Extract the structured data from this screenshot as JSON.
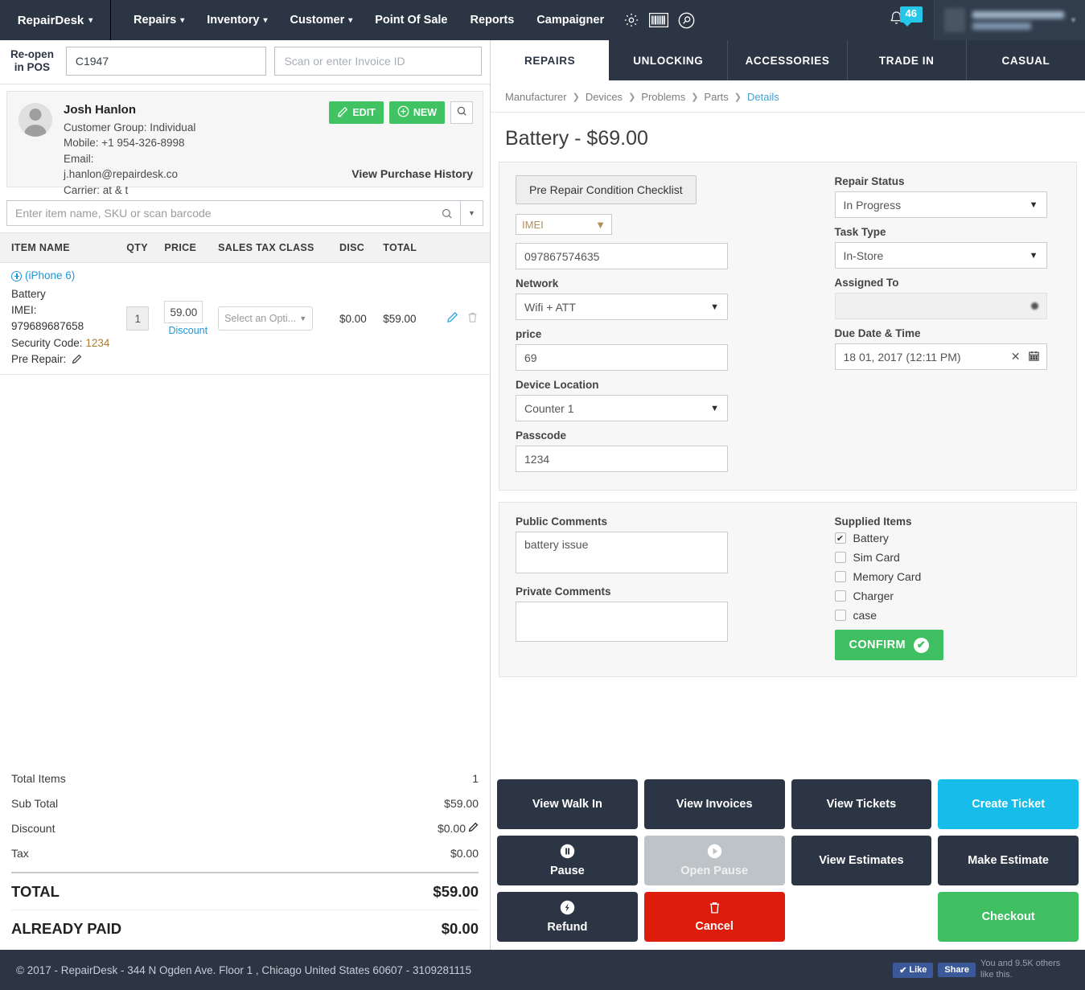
{
  "topnav": {
    "brand": "RepairDesk",
    "items": [
      {
        "label": "Repairs",
        "caret": true
      },
      {
        "label": "Inventory",
        "caret": true
      },
      {
        "label": "Customer",
        "caret": true
      },
      {
        "label": "Point Of Sale",
        "caret": false
      },
      {
        "label": "Reports",
        "caret": false
      },
      {
        "label": "Campaigner",
        "caret": false
      }
    ],
    "icons": [
      "gear-icon",
      "barcode-icon",
      "search-circle-icon"
    ],
    "notification_count": "46",
    "caret_glyph": "⌄"
  },
  "reopen": {
    "label_line1": "Re-open",
    "label_line2": "in POS",
    "ticket_value": "C1947",
    "ticket_placeholder": "",
    "invoice_placeholder": "Scan or enter Invoice ID",
    "invoice_value": ""
  },
  "customer": {
    "name": "Josh Hanlon",
    "group": "Customer Group: Individual",
    "mobile": "Mobile: +1 954-326-8998",
    "email_label": "Email:",
    "email": "j.hanlon@repairdesk.co",
    "carrier": "Carrier: at & t",
    "edit_label": "EDIT",
    "new_label": "NEW",
    "purchase_history": "View Purchase History"
  },
  "item_search": {
    "placeholder": "Enter item name, SKU or scan barcode",
    "value": ""
  },
  "cart": {
    "headers": [
      "ITEM NAME",
      "QTY",
      "PRICE",
      "SALES TAX CLASS",
      "DISC",
      "TOTAL"
    ],
    "row": {
      "device": "(iPhone 6)",
      "part": "Battery",
      "imei_label": "IMEI:",
      "imei_value": "979689687658",
      "security_label": "Security Code:",
      "security_value": "1234",
      "prerepair_label": "Pre Repair:",
      "qty": "1",
      "price": "59.00",
      "discount_link": "Discount",
      "tax_class": "Select an Opti...",
      "disc": "$0.00",
      "total": "$59.00"
    }
  },
  "totals": {
    "rows": [
      {
        "label": "Total Items",
        "value": "1",
        "editable": false
      },
      {
        "label": "Sub Total",
        "value": "$59.00",
        "editable": false
      },
      {
        "label": "Discount",
        "value": "$0.00",
        "editable": true
      },
      {
        "label": "Tax",
        "value": "$0.00",
        "editable": false
      }
    ],
    "total_label": "TOTAL",
    "total_value": "$59.00",
    "paid_label": "ALREADY PAID",
    "paid_value": "$0.00"
  },
  "tabs": [
    {
      "label": "REPAIRS",
      "active": true
    },
    {
      "label": "UNLOCKING",
      "active": false
    },
    {
      "label": "ACCESSORIES",
      "active": false
    },
    {
      "label": "TRADE IN",
      "active": false
    },
    {
      "label": "CASUAL",
      "active": false
    }
  ],
  "breadcrumb": [
    "Manufacturer",
    "Devices",
    "Problems",
    "Parts",
    "Details"
  ],
  "page_title": "Battery - $69.00",
  "form": {
    "checklist_button": "Pre Repair Condition Checklist",
    "id_type": "IMEI",
    "id_value": "097867574635",
    "network_label": "Network",
    "network_value": "Wifi + ATT",
    "price_label": "price",
    "price_value": "69",
    "device_location_label": "Device Location",
    "device_location_value": "Counter 1",
    "passcode_label": "Passcode",
    "passcode_value": "1234",
    "repair_status_label": "Repair Status",
    "repair_status_value": "In Progress",
    "task_type_label": "Task Type",
    "task_type_value": "In-Store",
    "assigned_to_label": "Assigned To",
    "assigned_to_value": "",
    "due_date_label": "Due Date & Time",
    "due_date_value": "18 01, 2017 (12:11 PM)"
  },
  "comments": {
    "public_label": "Public Comments",
    "public_value": "battery issue",
    "private_label": "Private Comments",
    "private_value": ""
  },
  "supplied": {
    "title": "Supplied Items",
    "items": [
      {
        "label": "Battery",
        "checked": true
      },
      {
        "label": "Sim Card",
        "checked": false
      },
      {
        "label": "Memory Card",
        "checked": false
      },
      {
        "label": "Charger",
        "checked": false
      },
      {
        "label": "case",
        "checked": false
      }
    ],
    "confirm_label": "CONFIRM"
  },
  "actions": [
    {
      "label": "View Walk In",
      "style": "dark",
      "icon": ""
    },
    {
      "label": "View Invoices",
      "style": "dark",
      "icon": ""
    },
    {
      "label": "View Tickets",
      "style": "dark",
      "icon": ""
    },
    {
      "label": "Create Ticket",
      "style": "cyan",
      "icon": ""
    },
    {
      "label": "Pause",
      "style": "dark",
      "icon": "pause-icon"
    },
    {
      "label": "Open Pause",
      "style": "grey",
      "icon": "play-icon"
    },
    {
      "label": "View Estimates",
      "style": "dark",
      "icon": ""
    },
    {
      "label": "Make Estimate",
      "style": "dark",
      "icon": ""
    },
    {
      "label": "Refund",
      "style": "dark",
      "icon": "refund-icon"
    },
    {
      "label": "Cancel",
      "style": "red",
      "icon": "trash-icon"
    },
    {
      "label": "",
      "style": "empty",
      "icon": ""
    },
    {
      "label": "Checkout",
      "style": "green",
      "icon": ""
    }
  ],
  "footer": {
    "copyright": "© 2017 - RepairDesk - 344 N Ogden Ave. Floor 1 , Chicago United States 60607 - 3109281115",
    "like_label": "Like",
    "share_label": "Share",
    "social_text": "You and 9.5K others like this."
  },
  "colors": {
    "navy": "#2b3544",
    "green": "#41c363",
    "cyan": "#17bde8",
    "red": "#dd1c0c",
    "link_blue": "#2196d6",
    "badge_cyan": "#26c6e8"
  }
}
